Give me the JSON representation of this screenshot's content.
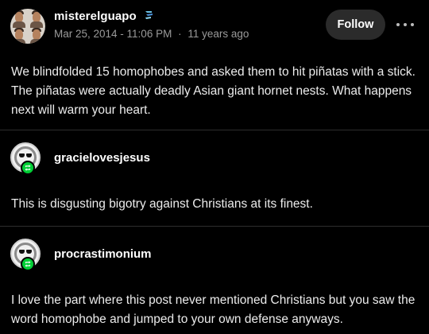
{
  "post": {
    "author": "misterelguapo",
    "date": "Mar 25, 2014 - 11:06 PM",
    "separator": "·",
    "ago": "11 years ago",
    "follow_label": "Follow",
    "body": "We blindfolded 15 homophobes and asked them to hit piñatas with a stick. The piñatas were actually deadly Asian giant hornet nests. What happens next will warm your heart."
  },
  "reblogs": [
    {
      "username": "gracielovesjesus",
      "avatar_icon": "sunglasses-avatar-icon",
      "badge_icon": "reblog-icon",
      "text": "This is disgusting bigotry against Christians at its finest."
    },
    {
      "username": "procrastimonium",
      "avatar_icon": "sunglasses-avatar-icon",
      "badge_icon": "reblog-icon",
      "text": "I love the part where this post never mentioned Christians but you saw the word homophobe and jumped to your own defense anyways."
    }
  ],
  "colors": {
    "background": "#000000",
    "reblog_green": "#00cf35",
    "follow_button_bg": "#2b2b2b",
    "muted_text": "#9a9a9a"
  }
}
